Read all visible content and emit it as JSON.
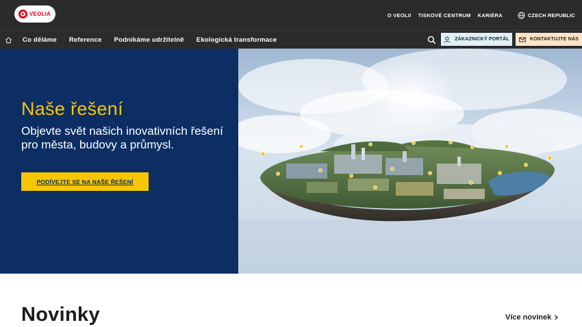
{
  "brand": {
    "logo_text": "VEOLIA",
    "color": "#e2001a"
  },
  "top_links": [
    "O VEOLII",
    "TISKOVÉ CENTRUM",
    "KARIÉRA"
  ],
  "country_selector": {
    "label": "CZECH REPUBLIC",
    "icon": "globe-icon"
  },
  "nav": {
    "home_icon": "home-icon",
    "items": [
      "Co děláme",
      "Reference",
      "Podnikáme udržitelně",
      "Ekologická transformace"
    ],
    "search_icon": "search-icon",
    "customer_portal": "ZÁKAZNICKÝ PORTÁL",
    "contact": "KONTAKTUJTE NÁS"
  },
  "hero": {
    "title": "Naše řešení",
    "text": "Objevte svět našich inovativních řešení pro města, budovy a průmysl.",
    "cta": "PODÍVEJTE SE NA NAŠE ŘEŠENÍ",
    "bg_color": "#0c2e63",
    "accent_color": "#f7c600"
  },
  "news": {
    "title": "Novinky",
    "more_link": "Více novinek"
  }
}
